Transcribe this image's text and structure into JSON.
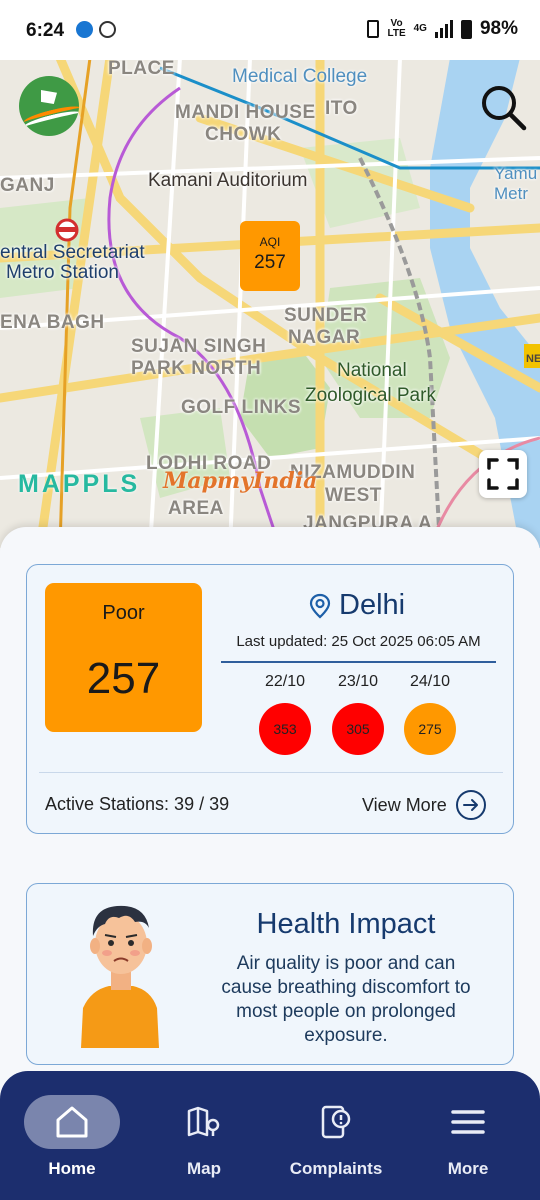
{
  "status_bar": {
    "time": "6:24",
    "network_top": "Vo",
    "network_bottom": "LTE",
    "cell": "4G",
    "battery": "98%"
  },
  "map": {
    "labels": {
      "medical_college": "Medical College",
      "mandi_house": "MANDI HOUSE",
      "chowk": "CHOWK",
      "ito": "ITO",
      "ganj": "GANJ",
      "kamani": "Kamani Auditorium",
      "yamuna": "Yamu",
      "metro": "Metr",
      "secretariat": "entral Secretariat",
      "metro_station": "Metro Station",
      "ena_bagh": "ENA BAGH",
      "sunder": "SUNDER",
      "nagar": "NAGAR",
      "sujan_singh": "SUJAN SINGH",
      "park_north": "PARK NORTH",
      "national": "National",
      "zoo": "Zoological Park",
      "golf_links": "GOLF LINKS",
      "lodhi_road": "LODHI ROAD",
      "nizamuddin": "NIZAMUDDIN",
      "west": "WEST",
      "area": "AREA",
      "jangpura": "JANGPURA A",
      "place": "PLACE",
      "ne": "NE"
    },
    "aqi_marker": {
      "label": "AQI",
      "value": "257"
    },
    "mappls": "MAPPLS",
    "mapmyindia": "MapmyIndia",
    "search_icon": "search-icon",
    "fullscreen_icon": "fullscreen-icon"
  },
  "aqi_card": {
    "category": "Poor",
    "aqi": "257",
    "city": "Delhi",
    "last_updated": "Last updated: 25 Oct 2025 06:05 AM",
    "forecast": [
      {
        "date": "22/10",
        "value": "353",
        "color": "#ff0000"
      },
      {
        "date": "23/10",
        "value": "305",
        "color": "#ff0000"
      },
      {
        "date": "24/10",
        "value": "275",
        "color": "#ff9800"
      }
    ],
    "active_stations": "Active Stations: 39 / 39",
    "view_more": "View More",
    "accent_color": "#ff9800"
  },
  "health_card": {
    "title": "Health Impact",
    "text": "Air quality is poor and can cause breathing discomfort to most people on prolonged exposure."
  },
  "bottom_nav": {
    "items": [
      {
        "label": "Home",
        "icon": "home-icon",
        "active": true
      },
      {
        "label": "Map",
        "icon": "map-icon",
        "active": false
      },
      {
        "label": "Complaints",
        "icon": "complaint-icon",
        "active": false
      },
      {
        "label": "More",
        "icon": "menu-icon",
        "active": false
      }
    ]
  }
}
